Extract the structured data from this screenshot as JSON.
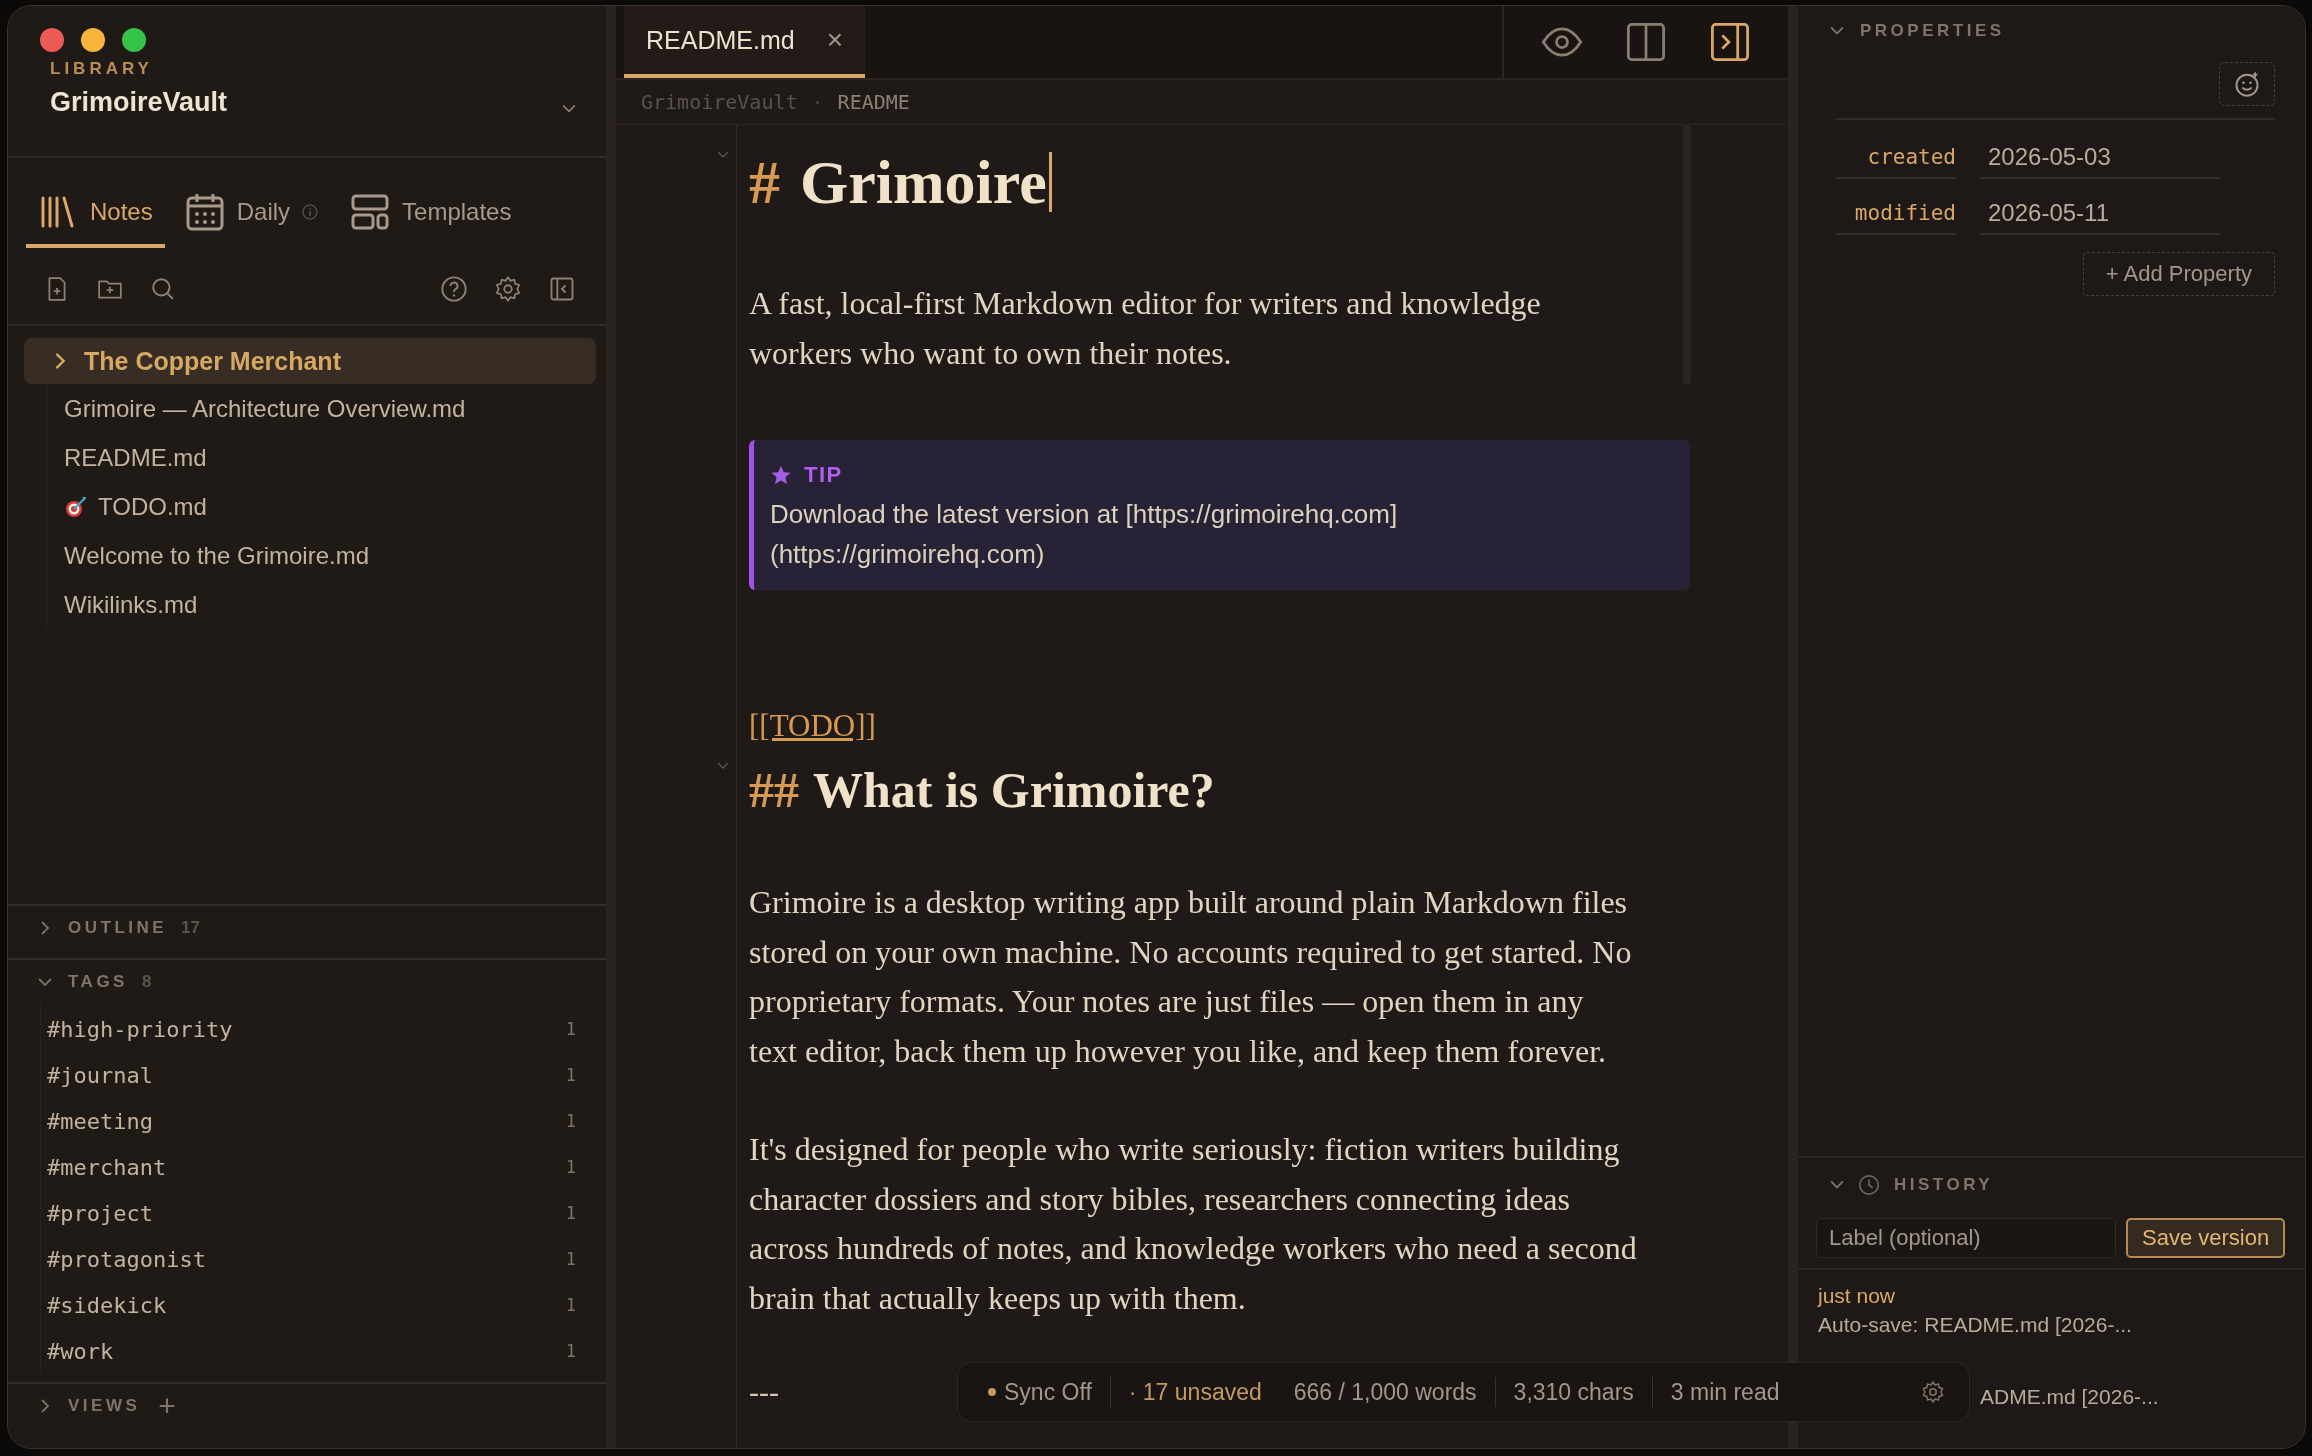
{
  "sidebar": {
    "section_label": "LIBRARY",
    "vault": "GrimoireVault",
    "tabs": [
      {
        "label": "Notes",
        "selected": true
      },
      {
        "label": "Daily",
        "selected": false
      },
      {
        "label": "Templates",
        "selected": false
      }
    ],
    "tree": [
      {
        "kind": "folder",
        "label": "The Copper Merchant",
        "selected": true
      },
      {
        "kind": "file",
        "label": "Grimoire — Architecture Overview.md",
        "selected": false,
        "icon": false
      },
      {
        "kind": "file",
        "label": "README.md",
        "selected": false,
        "icon": false
      },
      {
        "kind": "file",
        "label": "TODO.md",
        "selected": false,
        "icon": true
      },
      {
        "kind": "file",
        "label": "Welcome to the Grimoire.md",
        "selected": false,
        "icon": false
      },
      {
        "kind": "file",
        "label": "Wikilinks.md",
        "selected": false,
        "icon": false
      }
    ],
    "outline": {
      "title": "OUTLINE",
      "count": "17",
      "expanded": false
    },
    "tags": {
      "title": "TAGS",
      "count": "8",
      "expanded": true,
      "items": [
        {
          "name": "#high-priority",
          "count": "1"
        },
        {
          "name": "#journal",
          "count": "1"
        },
        {
          "name": "#meeting",
          "count": "1"
        },
        {
          "name": "#merchant",
          "count": "1"
        },
        {
          "name": "#project",
          "count": "1"
        },
        {
          "name": "#protagonist",
          "count": "1"
        },
        {
          "name": "#sidekick",
          "count": "1"
        },
        {
          "name": "#work",
          "count": "1"
        }
      ]
    },
    "views": {
      "title": "VIEWS",
      "add": "+",
      "expanded": false
    }
  },
  "editor": {
    "tab": {
      "label": "README.md",
      "close": "×"
    },
    "view_modes": [
      {
        "selected": false
      },
      {
        "selected": false
      },
      {
        "selected": true
      }
    ],
    "breadcrumb": {
      "separator": "·",
      "items": [
        "GrimoireVault",
        "README"
      ]
    },
    "blocks": [
      {
        "kind": "h1",
        "marker": "#",
        "text": "Grimoire",
        "cursor": true
      },
      {
        "kind": "p",
        "text": "A fast, local-first Markdown editor for writers and knowledge workers who want to own their notes."
      },
      {
        "kind": "callout",
        "label": "TIP",
        "text": "Download the latest version at [https://grimoirehq.com](https://grimoirehq.com)"
      },
      {
        "kind": "link",
        "text": "[[TODO]]"
      },
      {
        "kind": "h2",
        "marker": "##",
        "text": "What is Grimoire?"
      },
      {
        "kind": "p",
        "text": "Grimoire is a desktop writing app built around plain Markdown files stored on your own machine. No accounts required to get started. No proprietary formats. Your notes are just files — open them in any text editor, back them up however you like, and keep them forever."
      },
      {
        "kind": "p",
        "text": "It's designed for people who write seriously: fiction writers building character dossiers and story bibles, researchers connecting ideas across hundreds of notes, and knowledge workers who need a second brain that actually keeps up with them."
      },
      {
        "kind": "hr",
        "text": "---"
      }
    ]
  },
  "status_bar": {
    "groups": [
      [
        {
          "text": "Sync Off",
          "dot": true,
          "accent": false
        }
      ],
      [
        {
          "text": "· 17 unsaved",
          "dot": false,
          "accent": true
        },
        {
          "text": "666 / 1,000 words",
          "dot": false,
          "accent": false
        }
      ],
      [
        {
          "text": "3,310 chars",
          "dot": false,
          "accent": false
        }
      ],
      [
        {
          "text": "3 min read",
          "dot": false,
          "accent": false
        }
      ]
    ]
  },
  "properties": {
    "title": "PROPERTIES",
    "expanded": true,
    "items": [
      {
        "key": "created",
        "value": "2026-05-03"
      },
      {
        "key": "modified",
        "value": "2026-05-11"
      }
    ],
    "add_button": "+ Add Property"
  },
  "history": {
    "title": "HISTORY",
    "expanded": true,
    "placeholder": "Label (optional)",
    "save_button": "Save version",
    "entries": [
      {
        "time": "just now",
        "text": "Auto-save: README.md [2026-..."
      },
      {
        "text": "ADME.md [2026-..."
      }
    ]
  }
}
